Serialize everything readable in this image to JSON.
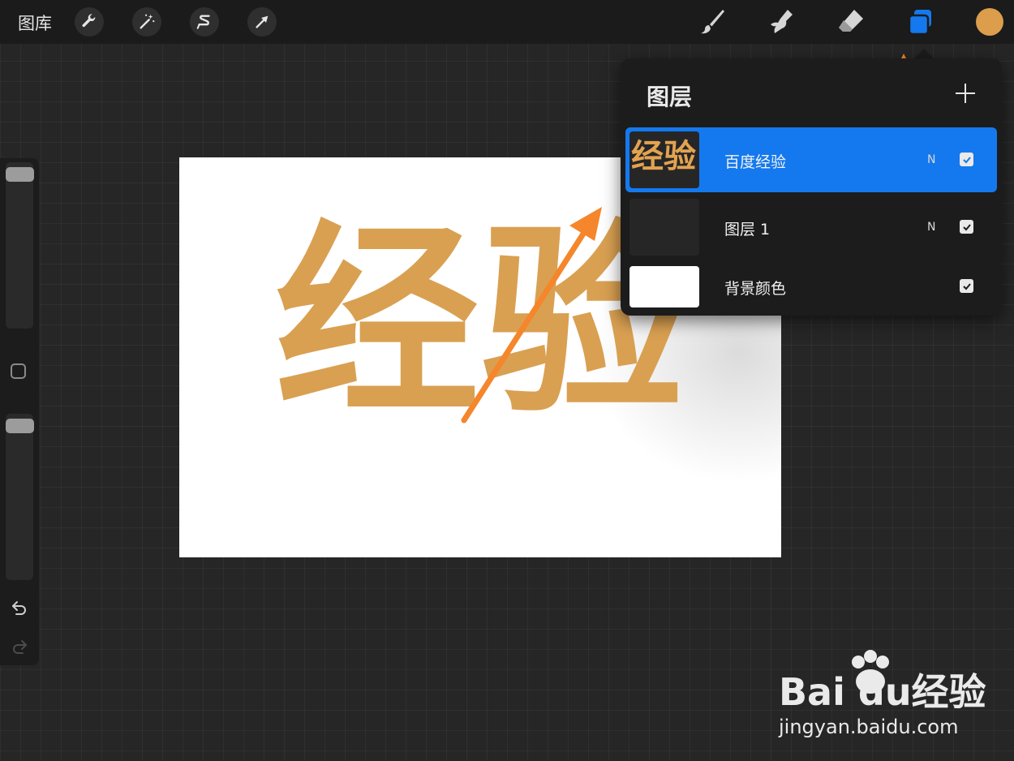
{
  "toolbar": {
    "gallery_label": "图库",
    "left_tools": [
      {
        "name": "actions",
        "icon": "wrench-icon"
      },
      {
        "name": "adjustments",
        "icon": "magic-wand-icon"
      },
      {
        "name": "selection",
        "icon": "selection-s-icon"
      },
      {
        "name": "transform",
        "icon": "transform-arrow-icon"
      }
    ],
    "right_tools": [
      {
        "name": "brush",
        "icon": "brush-icon"
      },
      {
        "name": "smudge",
        "icon": "smudge-icon"
      },
      {
        "name": "eraser",
        "icon": "eraser-icon"
      },
      {
        "name": "layers",
        "icon": "layers-icon",
        "active": true
      }
    ],
    "current_color": "#dc9d4c",
    "active_color": "#1479ee"
  },
  "sidebar": {
    "brush_size_level": 0.03,
    "opacity_level": 0.03,
    "modifier_icon": "square-modifier-icon",
    "undo_icon": "undo-icon",
    "redo_icon": "redo-icon"
  },
  "canvas": {
    "text": "经验",
    "text_color": "#d9a052",
    "background": "#ffffff"
  },
  "layers_panel": {
    "title": "图层",
    "add_icon": "plus-icon",
    "layers": [
      {
        "name": "百度经验",
        "blend": "N",
        "visible": true,
        "active": true,
        "thumb_text": "经验"
      },
      {
        "name": "图层 1",
        "blend": "N",
        "visible": true,
        "active": false
      },
      {
        "name": "背景颜色",
        "visible": true,
        "active": false
      }
    ]
  },
  "annotation": {
    "arrow_color": "#f5862b"
  },
  "watermark": {
    "text": "Bai du经验",
    "url": "jingyan.baidu.com"
  }
}
